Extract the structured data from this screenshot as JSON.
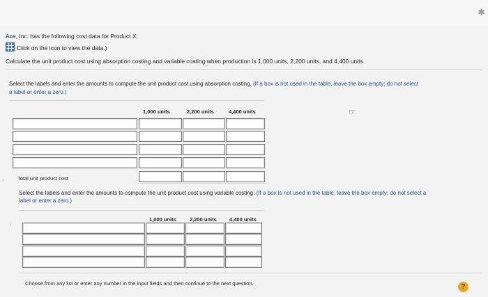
{
  "intro": {
    "problem_text": "Ace, Inc. has the following cost data for Product X:",
    "data_link_text": "Click on the icon to view the data.)",
    "question_text": "Calculate the unit product cost using absorption costing and variable costing when production is 1,000 units, 2,200 units, and 4,400 units."
  },
  "absorption": {
    "instruction": "Select the labels and enter the amounts to compute the unit product cost using absorption costing.",
    "note_a": "(If a box is not used in the table, leave the box empty; do not select",
    "note_b": "a label or enter a zero.)",
    "columns": [
      "1,000 units",
      "2,200 units",
      "4,400 units"
    ],
    "total_label": "Total unit product cost"
  },
  "variable": {
    "instruction": "Select the labels and enter the amounts to compute the unit product cost using variable costing.",
    "note_a": "(If a box is not used in the table, leave the box empty; do not select a",
    "note_b": "label or enter a zero.)",
    "columns": [
      "1,000 units",
      "2,200 units",
      "4,400 units"
    ]
  },
  "footer": {
    "hint": "Choose from any list or enter any number in the input fields and then continue to the next question.",
    "help_label": "?"
  },
  "icons": {
    "top_corner": "star-icon",
    "data": "table-grid-icon",
    "cursor": "hand-pointer-icon",
    "help": "question-mark-icon"
  }
}
